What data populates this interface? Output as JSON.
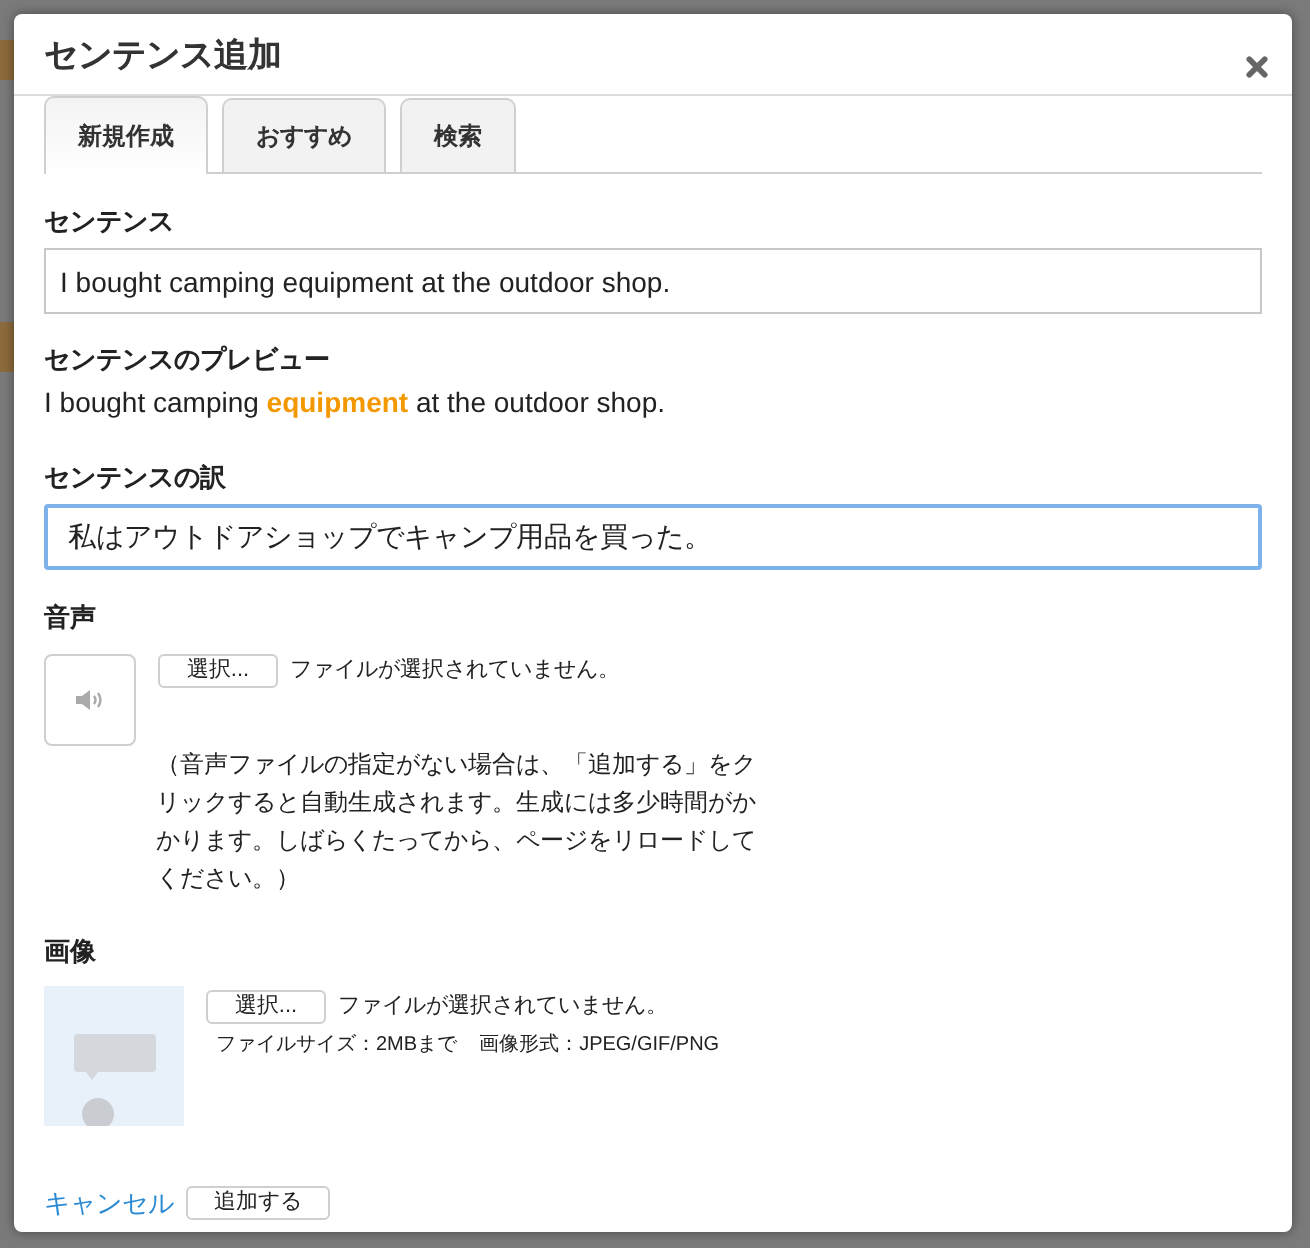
{
  "dialog": {
    "title": "センテンス追加"
  },
  "tabs": [
    {
      "label": "新規作成",
      "selected": true
    },
    {
      "label": "おすすめ",
      "selected": false
    },
    {
      "label": "検索",
      "selected": false
    }
  ],
  "sentence": {
    "label": "センテンス",
    "value": "I bought camping equipment at the outdoor shop."
  },
  "preview": {
    "label": "センテンスのプレビュー",
    "text": "I bought camping **equipment** at the outdoor shop."
  },
  "translation": {
    "label": "センテンスの訳",
    "value": "私はアウトドアショップでキャンプ用品を買った。",
    "focused": true
  },
  "audio": {
    "label": "音声",
    "button": "選択...",
    "file_status": "ファイルが選択されていません。",
    "note": "（音声ファイルの指定がない場合は、「追加する」をクリックすると自動生成されます。生成には多少時間がかかります。しばらくたってから、ページをリロードしてください。）"
  },
  "image": {
    "label": "画像",
    "button": "選択...",
    "file_status": "ファイルが選択されていません。",
    "size_limit": "ファイルサイズ：2MBまで",
    "formats": "画像形式：JPEG/GIF/PNG"
  },
  "actions": {
    "cancel": "キャンセル",
    "submit": "追加する"
  }
}
